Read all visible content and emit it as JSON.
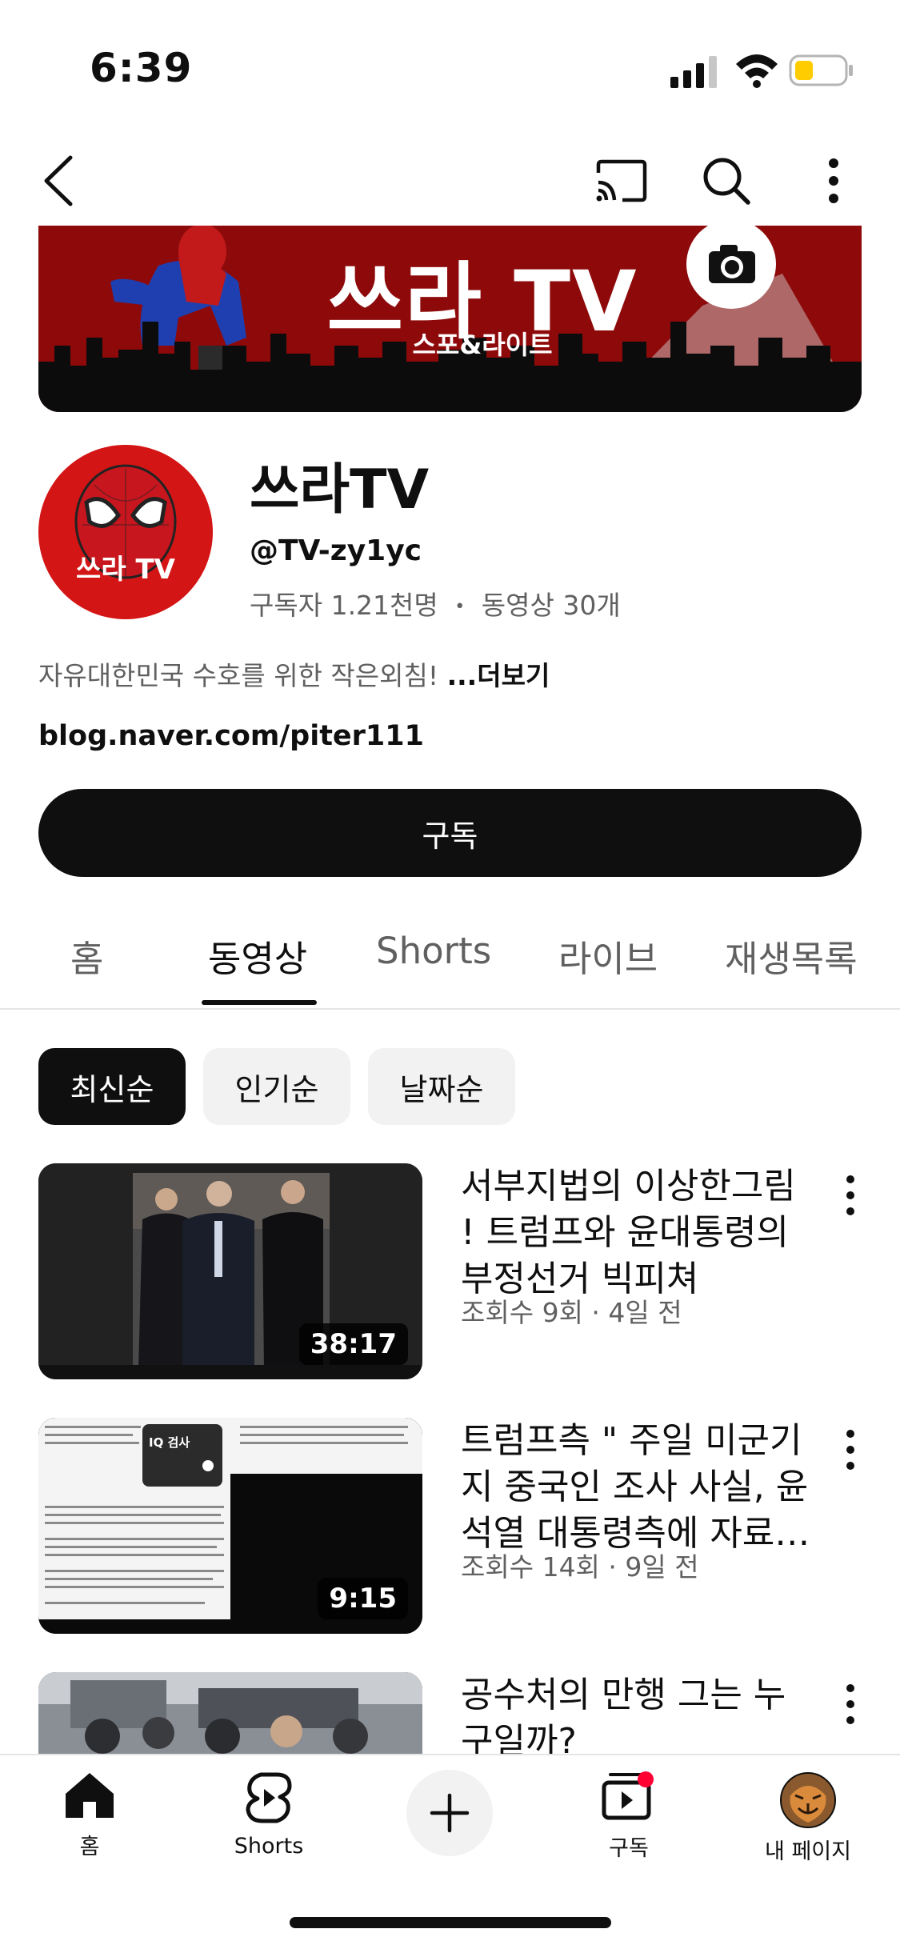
{
  "status": {
    "time": "6:39"
  },
  "banner": {
    "title": "쓰라 TV",
    "subtitle": "스포&라이트"
  },
  "channel": {
    "avatar_text": "쓰라 TV",
    "name": "쓰라TV",
    "handle": "@TV-zy1yc",
    "subscribers": "구독자 1.21천명",
    "separator": "•",
    "videos": "동영상 30개",
    "description": "자유대한민국 수호를 위한 작은외침!",
    "more_label": "...더보기",
    "link": "blog.naver.com/piter111",
    "subscribe_label": "구독"
  },
  "tabs": [
    {
      "label": "홈"
    },
    {
      "label": "동영상",
      "active": true
    },
    {
      "label": "Shorts"
    },
    {
      "label": "라이브"
    },
    {
      "label": "재생목록"
    }
  ],
  "chips": [
    {
      "label": "최신순",
      "active": true
    },
    {
      "label": "인기순"
    },
    {
      "label": "날짜순"
    }
  ],
  "videos": [
    {
      "title": "서부지법의 이상한그림 ! 트럼프와 윤대통령의 부정선거 빅피쳐",
      "meta": "조회수 9회 · 4일 전",
      "duration": "38:17"
    },
    {
      "title": "트럼프측 \" 주일 미군기지 중국인 조사 사실, 윤석열 대통령측에 자료…",
      "meta": "조회수 14회 · 9일 전",
      "duration": "9:15",
      "overlay_label": "IQ 검사"
    },
    {
      "title": "공수처의 만행 그는 누구일까?"
    }
  ],
  "bottom_nav": {
    "home": "홈",
    "shorts": "Shorts",
    "subscriptions": "구독",
    "you": "내 페이지"
  },
  "colors": {
    "brand_red": "#8e0a0a",
    "text": "#0f0f0f",
    "secondary": "#606060",
    "notification": "#ff0033"
  }
}
